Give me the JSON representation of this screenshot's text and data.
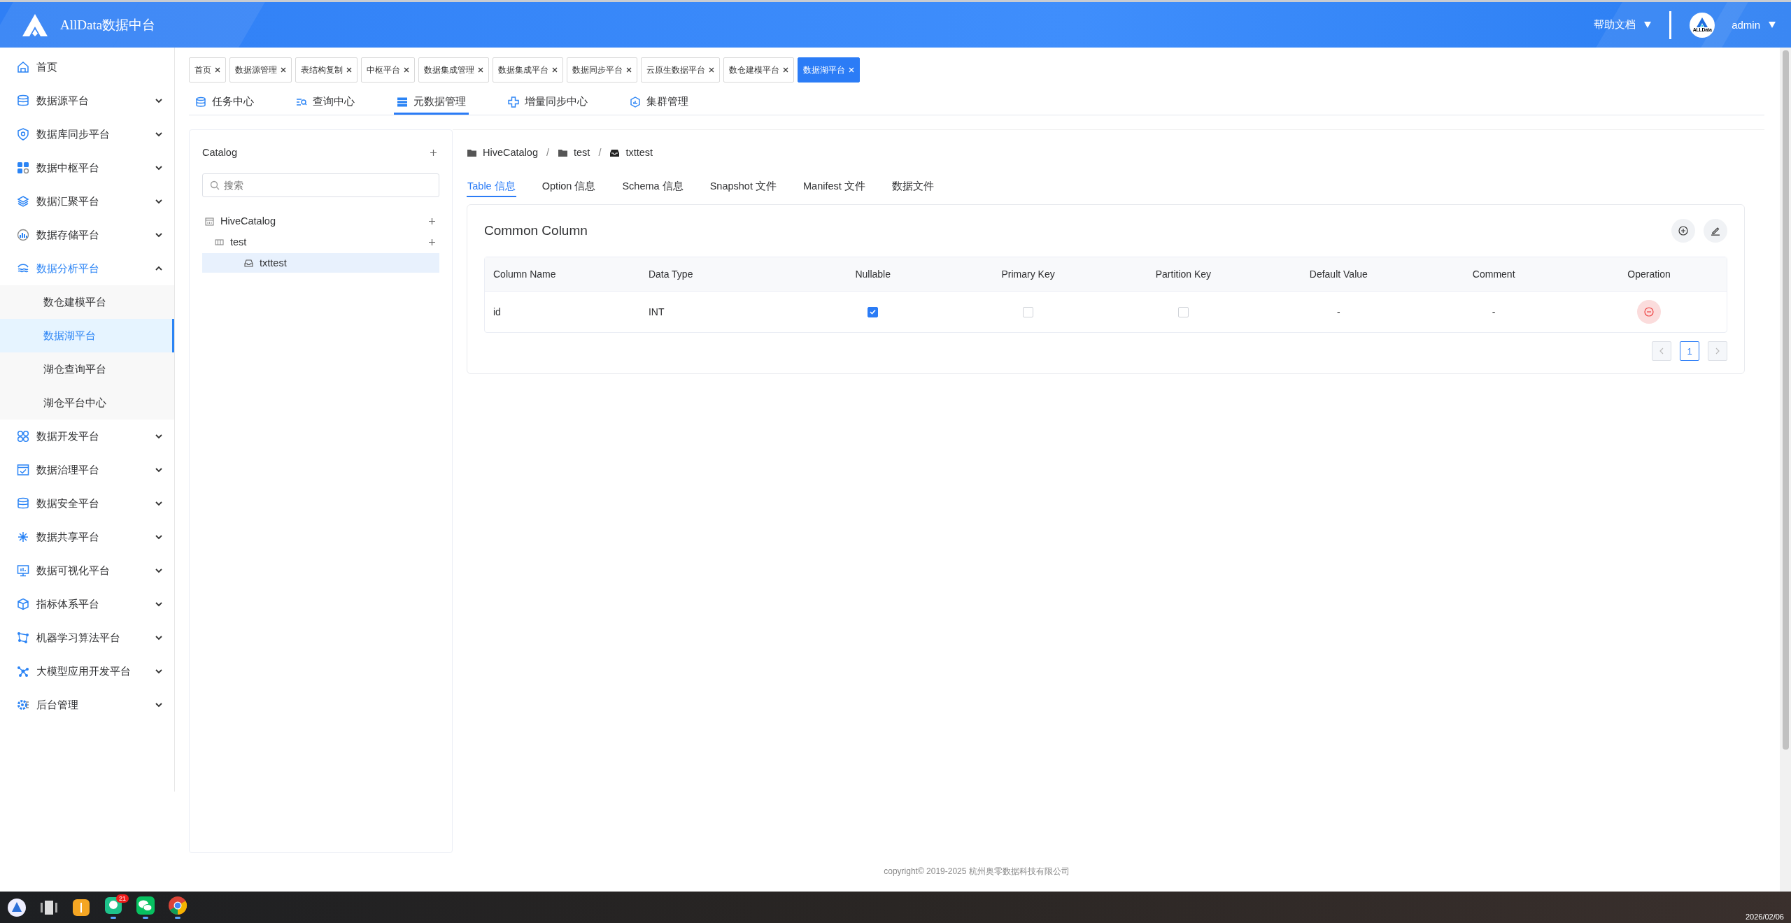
{
  "header": {
    "brand": "AllData数据中台",
    "help": "帮助文档",
    "avatar_text": "ALLData",
    "user": "admin"
  },
  "sidebar": {
    "items": [
      {
        "kind": "link",
        "label": "首页"
      },
      {
        "kind": "group",
        "label": "数据源平台",
        "expanded": false
      },
      {
        "kind": "group",
        "label": "数据库同步平台",
        "expanded": false
      },
      {
        "kind": "group",
        "label": "数据中枢平台",
        "expanded": false
      },
      {
        "kind": "group",
        "label": "数据汇聚平台",
        "expanded": false
      },
      {
        "kind": "group",
        "label": "数据存储平台",
        "expanded": false
      },
      {
        "kind": "group",
        "label": "数据分析平台",
        "expanded": true,
        "children": [
          {
            "label": "数仓建模平台",
            "selected": false
          },
          {
            "label": "数据湖平台",
            "selected": true
          },
          {
            "label": "湖仓查询平台",
            "selected": false
          },
          {
            "label": "湖仓平台中心",
            "selected": false
          }
        ]
      },
      {
        "kind": "group",
        "label": "数据开发平台",
        "expanded": false
      },
      {
        "kind": "group",
        "label": "数据治理平台",
        "expanded": false
      },
      {
        "kind": "group",
        "label": "数据安全平台",
        "expanded": false
      },
      {
        "kind": "group",
        "label": "数据共享平台",
        "expanded": false
      },
      {
        "kind": "group",
        "label": "数据可视化平台",
        "expanded": false
      },
      {
        "kind": "group",
        "label": "指标体系平台",
        "expanded": false
      },
      {
        "kind": "group",
        "label": "机器学习算法平台",
        "expanded": false
      },
      {
        "kind": "group",
        "label": "大模型应用开发平台",
        "expanded": false
      },
      {
        "kind": "group",
        "label": "后台管理",
        "expanded": false
      }
    ]
  },
  "tags": [
    {
      "label": "首页",
      "selected": false
    },
    {
      "label": "数据源管理",
      "selected": false
    },
    {
      "label": "表结构复制",
      "selected": false
    },
    {
      "label": "中枢平台",
      "selected": false
    },
    {
      "label": "数据集成管理",
      "selected": false
    },
    {
      "label": "数据集成平台",
      "selected": false
    },
    {
      "label": "数据同步平台",
      "selected": false
    },
    {
      "label": "云原生数据平台",
      "selected": false
    },
    {
      "label": "数仓建模平台",
      "selected": false
    },
    {
      "label": "数据湖平台",
      "selected": true
    }
  ],
  "tabs": [
    {
      "label": "任务中心",
      "selected": false
    },
    {
      "label": "查询中心",
      "selected": false
    },
    {
      "label": "元数据管理",
      "selected": true
    },
    {
      "label": "增量同步中心",
      "selected": false
    },
    {
      "label": "集群管理",
      "selected": false
    }
  ],
  "catalog": {
    "title": "Catalog",
    "search": {
      "placeholder": "搜索"
    },
    "tree": [
      {
        "kind": "catalog",
        "label": "HiveCatalog",
        "selected": false,
        "children": [
          {
            "kind": "database",
            "label": "test",
            "selected": false,
            "children": [
              {
                "kind": "table",
                "label": "txttest",
                "selected": true
              }
            ]
          }
        ]
      }
    ]
  },
  "detail": {
    "breadcrumb": [
      {
        "kind": "folder",
        "label": "HiveCatalog"
      },
      {
        "kind": "folder",
        "label": "test",
        "separator": "/"
      },
      {
        "kind": "table",
        "label": "txttest",
        "separator": "/"
      }
    ],
    "tabs": [
      {
        "label": "Table 信息",
        "selected": true
      },
      {
        "label": "Option 信息",
        "selected": false
      },
      {
        "label": "Schema 信息",
        "selected": false
      },
      {
        "label": "Snapshot 文件",
        "selected": false
      },
      {
        "label": "Manifest 文件",
        "selected": false
      },
      {
        "label": "数据文件",
        "selected": false
      }
    ],
    "card": {
      "title": "Common Column",
      "columns": [
        "Column Name",
        "Data Type",
        "Nullable",
        "Primary Key",
        "Partition Key",
        "Default Value",
        "Comment",
        "Operation"
      ],
      "rows": [
        {
          "name": "id",
          "type": "INT",
          "nullable": true,
          "primary_key": false,
          "partition_key": false,
          "default": "-",
          "comment": "-"
        }
      ],
      "pages": [
        {
          "label": "1",
          "selected": true
        }
      ]
    }
  },
  "footer": {
    "copyright": "copyright© 2019-2025 杭州奥零数据科技有限公司"
  },
  "taskbar": {
    "apps": [
      {
        "kind": "launcher"
      },
      {
        "kind": "windows"
      },
      {
        "kind": "tool"
      },
      {
        "kind": "chat",
        "badge": "21",
        "running": true
      },
      {
        "kind": "wechat",
        "running": true
      },
      {
        "kind": "browser",
        "running": true
      }
    ],
    "date": "2026/02/06"
  }
}
